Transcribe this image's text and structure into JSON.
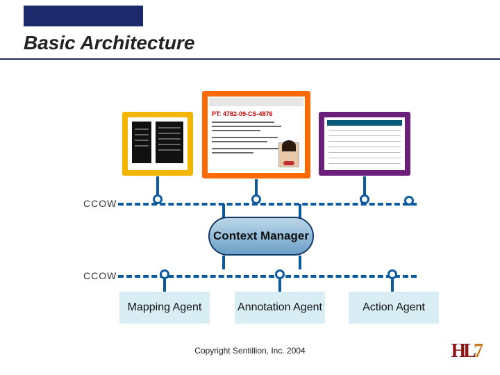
{
  "title": "Basic Architecture",
  "bus_label_top": "CCOW",
  "bus_label_bottom": "CCOW",
  "context_manager": "Context Manager",
  "agents": {
    "mapping": "Mapping Agent",
    "annotation": "Annotation Agent",
    "action": "Action Agent"
  },
  "footer": "Copyright Sentillion, Inc. 2004",
  "logo_text": "HL7",
  "app2_header": "PT: 4782-09-CS-4876",
  "colors": {
    "accent": "#1c2a6b",
    "bus": "#0b5aa0",
    "app1": "#f2b600",
    "app2": "#ff6a00",
    "app3": "#6b1f7a",
    "agent_bg": "#d8eef4"
  }
}
